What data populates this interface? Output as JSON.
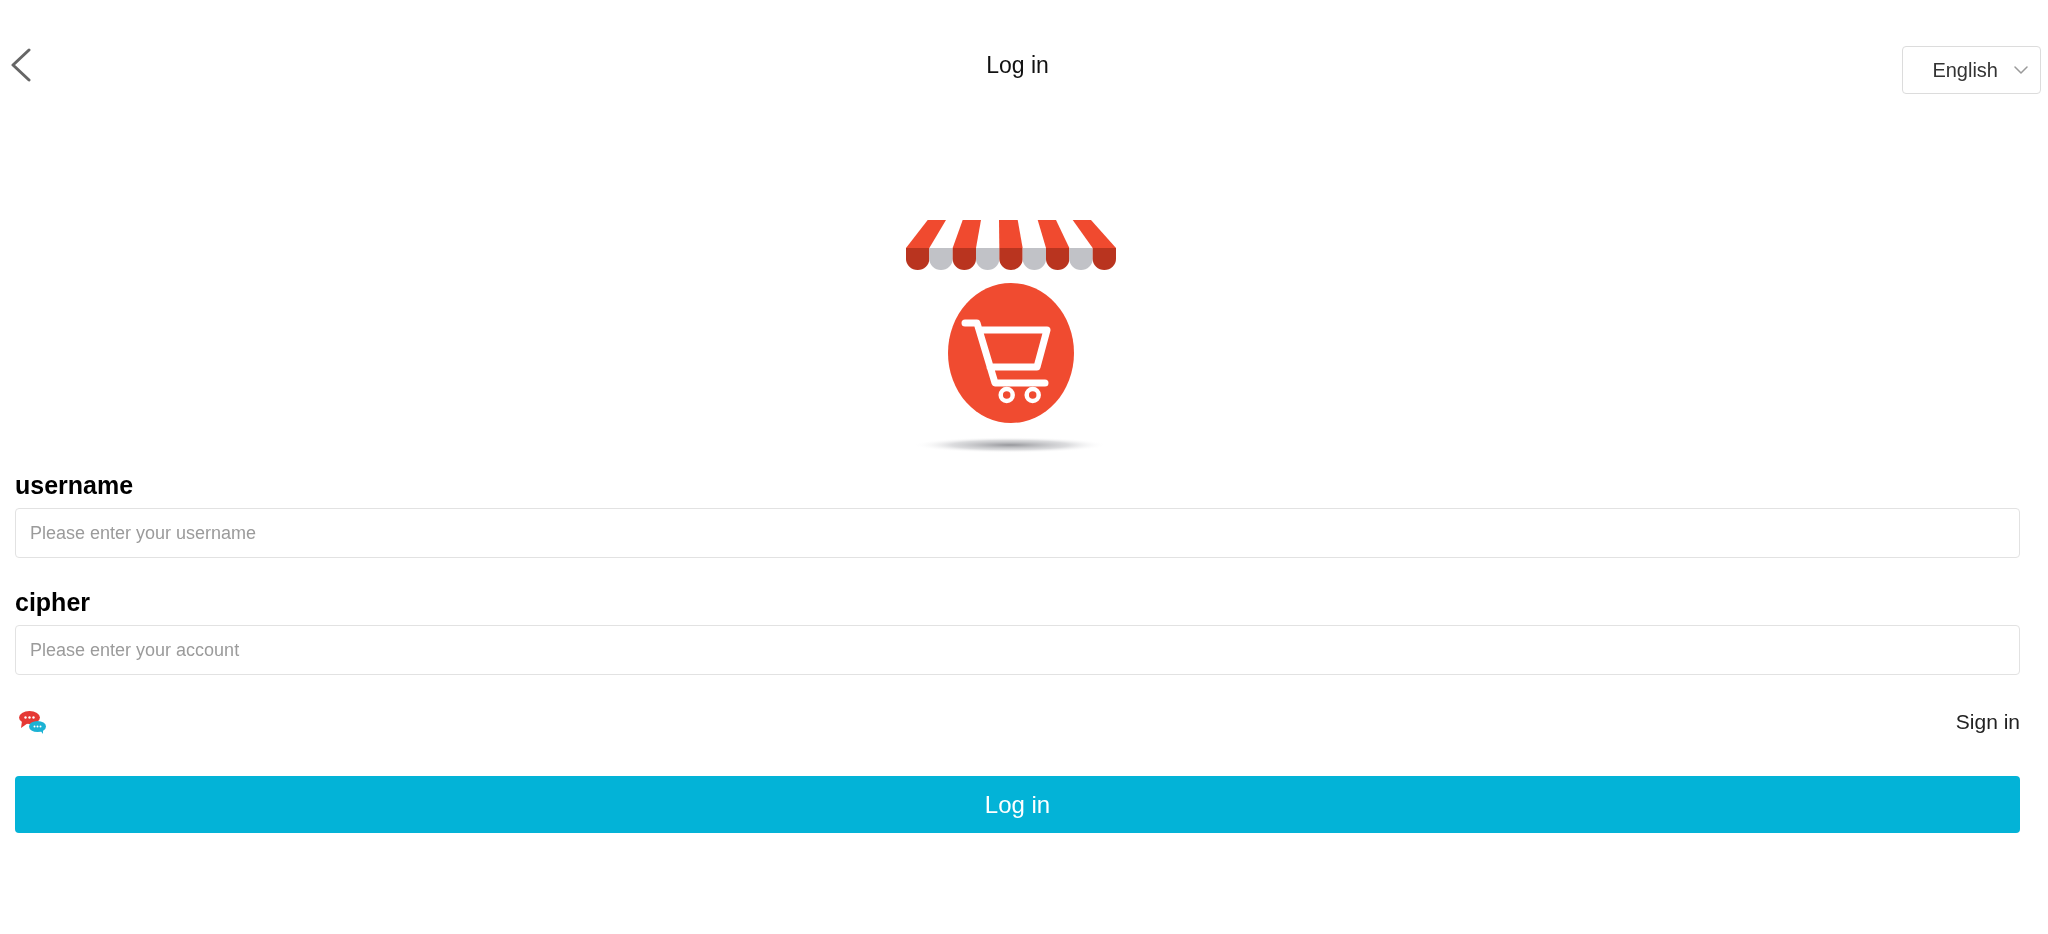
{
  "header": {
    "title": "Log in",
    "language_select": {
      "value": "English"
    }
  },
  "form": {
    "fields": [
      {
        "label": "username",
        "placeholder": "Please enter your username"
      },
      {
        "label": "cipher",
        "placeholder": "Please enter your account"
      }
    ],
    "sign_in_link": "Sign in",
    "submit_button": "Log in"
  }
}
